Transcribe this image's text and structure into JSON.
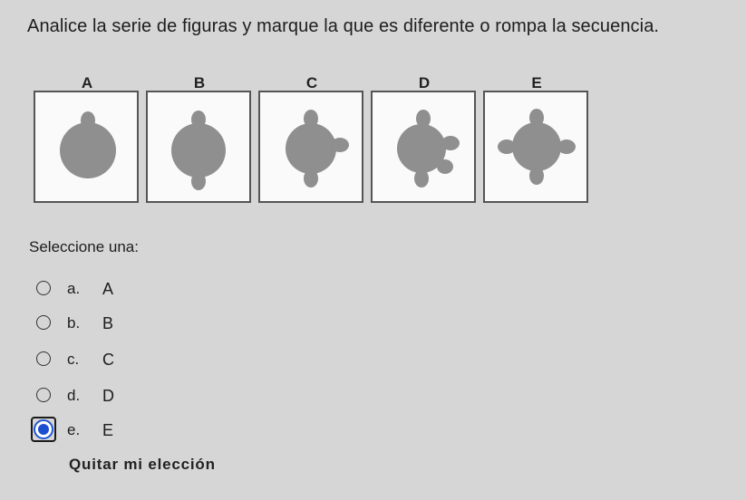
{
  "question": {
    "text": "Analice la serie de figuras y marque la que es diferente o rompa la secuencia."
  },
  "figures": [
    {
      "letter": "A"
    },
    {
      "letter": "B"
    },
    {
      "letter": "C"
    },
    {
      "letter": "D"
    },
    {
      "letter": "E"
    }
  ],
  "prompt": {
    "select_label": "Seleccione una:"
  },
  "options": [
    {
      "letter": "a.",
      "text": "A",
      "selected": false
    },
    {
      "letter": "b.",
      "text": "B",
      "selected": false
    },
    {
      "letter": "c.",
      "text": "C",
      "selected": false
    },
    {
      "letter": "d.",
      "text": "D",
      "selected": false
    },
    {
      "letter": "e.",
      "text": "E",
      "selected": true
    }
  ],
  "actions": {
    "clear_choice": "Quitar mi elección"
  },
  "colors": {
    "background": "#d6d6d6",
    "figure_fill": "#8f8f8f",
    "radio_selected": "#1b4fcf"
  }
}
